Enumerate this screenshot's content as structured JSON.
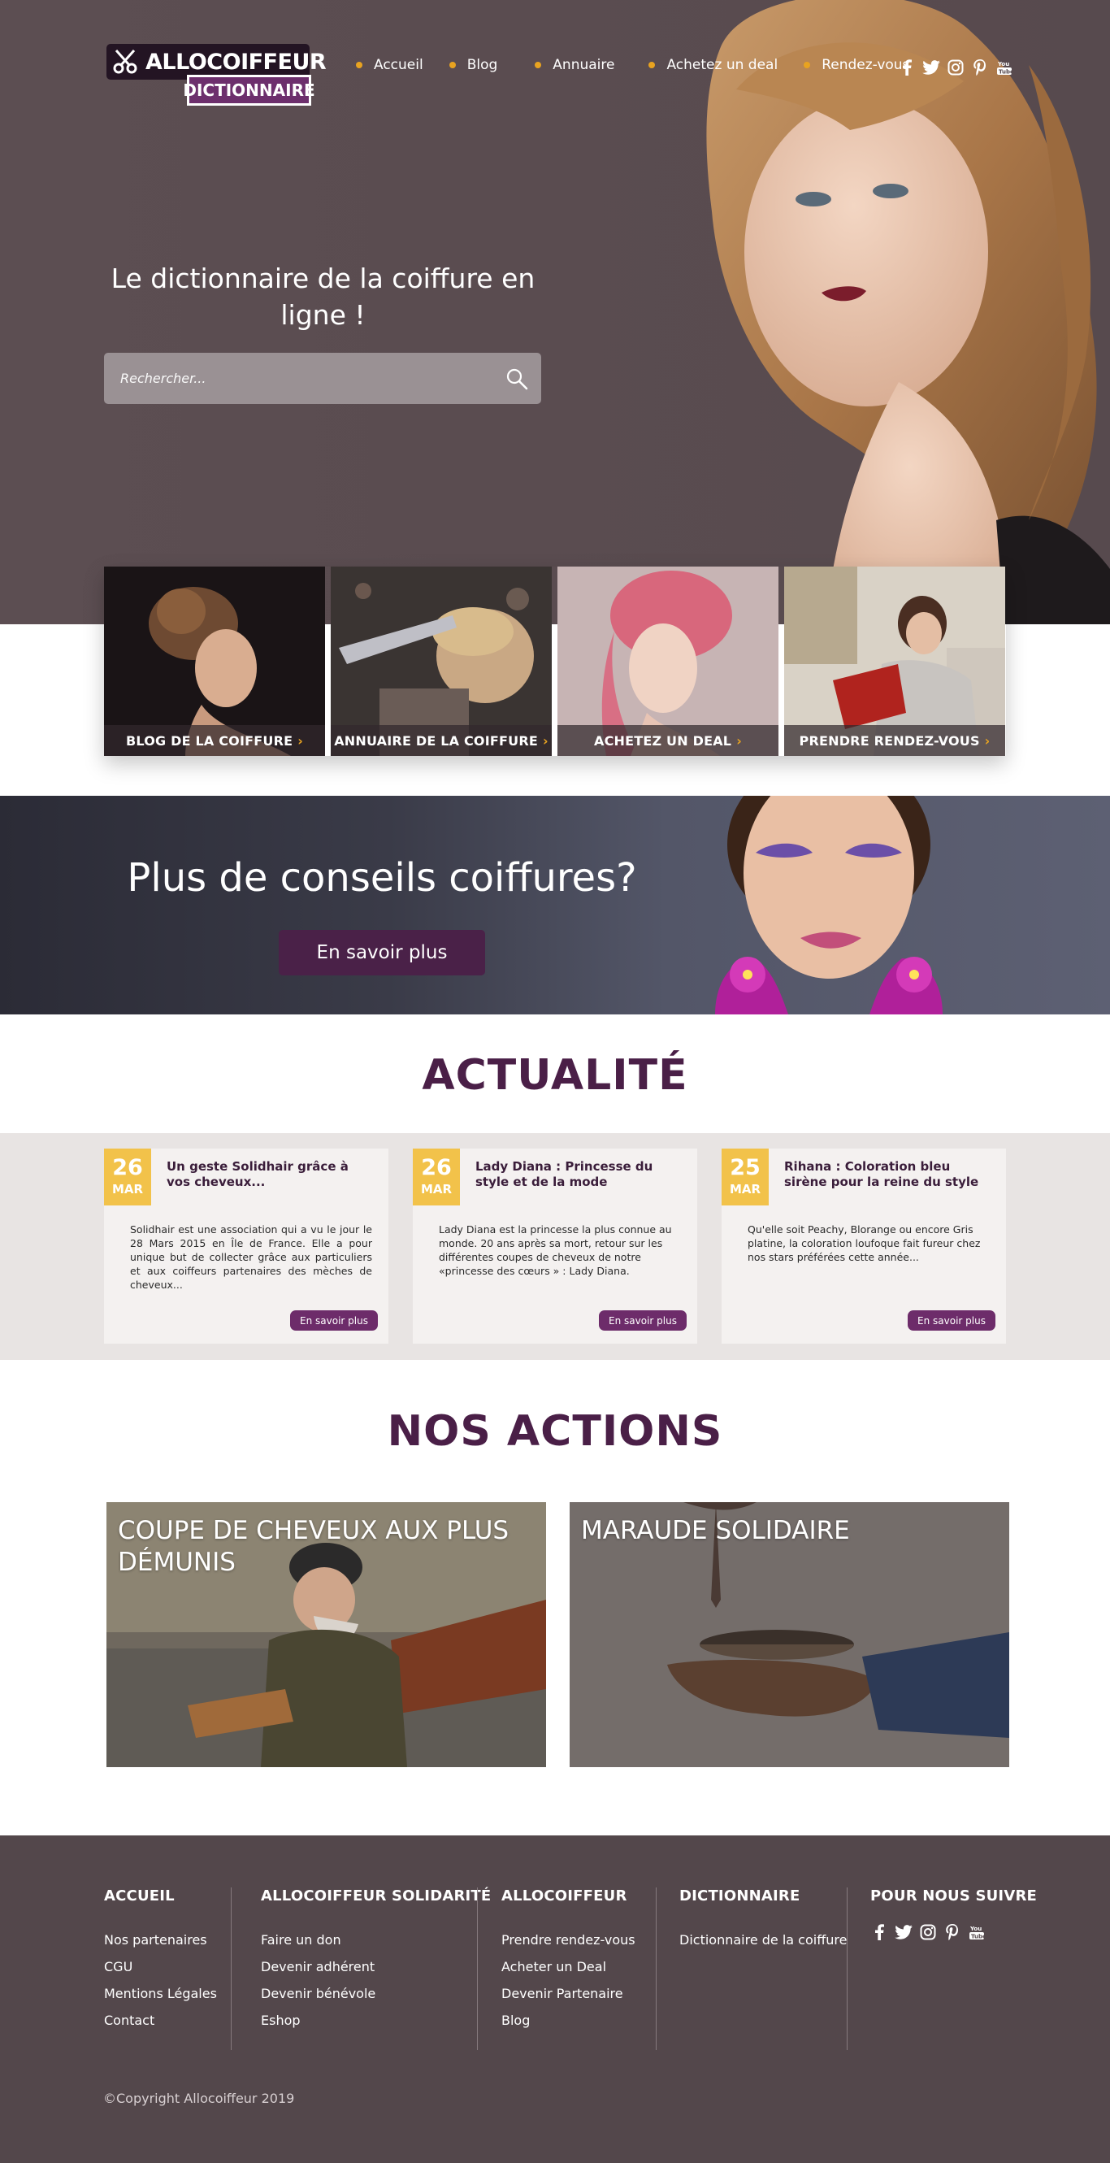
{
  "brand": {
    "name": "ALLOCOIFFEUR",
    "tagline": "DICTIONNAIRE"
  },
  "nav": {
    "items": [
      {
        "label": "Accueil"
      },
      {
        "label": "Blog"
      },
      {
        "label": "Annuaire"
      },
      {
        "label": "Achetez un deal"
      },
      {
        "label": "Rendez-vous"
      }
    ]
  },
  "social": {
    "icons": [
      "facebook-icon",
      "twitter-icon",
      "instagram-icon",
      "pinterest-icon",
      "youtube-icon"
    ]
  },
  "hero": {
    "title": "Le dictionnaire de la coiffure en ligne !",
    "search_placeholder": "Rechercher..."
  },
  "categories": [
    {
      "label": "BLOG DE LA COIFFURE"
    },
    {
      "label": "ANNUAIRE DE LA COIFFURE"
    },
    {
      "label": "ACHETEZ UN DEAL"
    },
    {
      "label": "PRENDRE RENDEZ-VOUS"
    }
  ],
  "promo": {
    "title": "Plus de conseils coiffures?",
    "button": "En savoir plus"
  },
  "news": {
    "title": "ACTUALITÉ",
    "items": [
      {
        "day": "26",
        "month": "MAR",
        "title": "Un geste Solidhair grâce à vos cheveux...",
        "text": "Solidhair est une association qui a vu le jour le 28 Mars 2015 en Île de France. Elle a pour unique but de collecter grâce aux particuliers et aux coiffeurs partenaires des mèches de cheveux...",
        "button": "En savoir plus"
      },
      {
        "day": "26",
        "month": "MAR",
        "title": "Lady Diana : Princesse du style et de la mode",
        "text": "Lady Diana est la princesse la plus connue au monde. 20 ans après sa mort, retour sur les différentes coupes de cheveux de notre «princesse des cœurs » : Lady Diana.",
        "button": "En savoir plus"
      },
      {
        "day": "25",
        "month": "MAR",
        "title": "Rihana : Coloration bleu sirène pour la reine du style",
        "text": "Qu'elle soit Peachy, Blorange ou encore Gris platine, la coloration loufoque fait fureur chez nos stars préférées cette année...",
        "button": "En savoir plus"
      }
    ]
  },
  "actions": {
    "title": "NOS ACTIONS",
    "items": [
      {
        "title": "COUPE DE CHEVEUX AUX PLUS DÉMUNIS"
      },
      {
        "title": "MARAUDE SOLIDAIRE"
      }
    ]
  },
  "footer": {
    "columns": [
      {
        "title": "ACCUEIL",
        "links": [
          "Nos partenaires",
          "CGU",
          "Mentions Légales",
          "Contact"
        ]
      },
      {
        "title": "ALLOCOIFFEUR SOLIDARITÉ",
        "links": [
          "Faire un don",
          "Devenir adhérent",
          "Devenir bénévole",
          "Eshop"
        ]
      },
      {
        "title": "ALLOCOIFFEUR",
        "links": [
          "Prendre rendez-vous",
          "Acheter un Deal",
          "Devenir Partenaire",
          "Blog"
        ]
      },
      {
        "title": "DICTIONNAIRE",
        "links": [
          "Dictionnaire de la coiffure"
        ]
      },
      {
        "title": "POUR NOUS SUIVRE"
      }
    ],
    "copyright": "©Copyright Allocoiffeur 2019"
  },
  "colors": {
    "brand_purple": "#4a1f47",
    "accent_yellow": "#f2c24a",
    "nav_dot": "#e8a320",
    "hero_bg": "#5a4c50",
    "footer_bg": "#53474b"
  }
}
